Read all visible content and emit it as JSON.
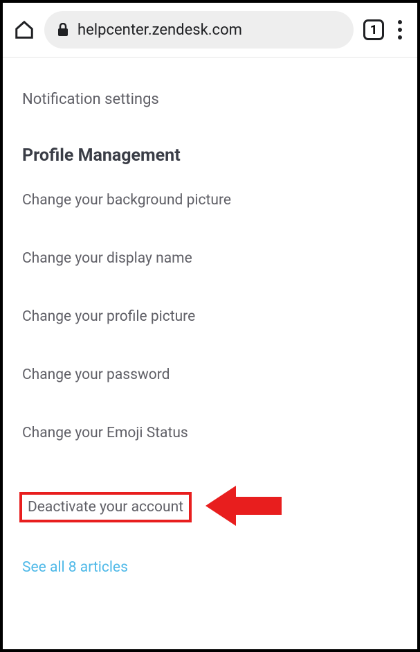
{
  "browser": {
    "url": "helpcenter.zendesk.com",
    "tab_count": "1"
  },
  "top_link": "Notification settings",
  "section": {
    "heading": "Profile Management",
    "articles": [
      "Change your background picture",
      "Change your display name",
      "Change your profile picture",
      "Change your password",
      "Change your Emoji Status"
    ],
    "highlighted": "Deactivate your account",
    "see_all": "See all 8 articles"
  }
}
